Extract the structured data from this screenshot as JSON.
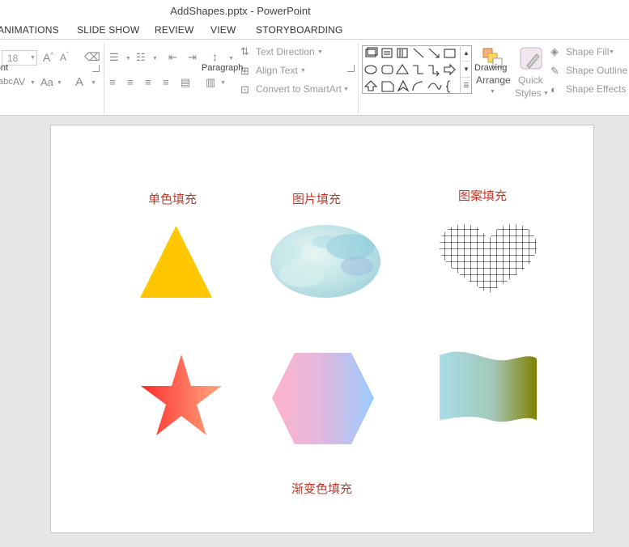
{
  "window": {
    "title": "AddShapes.pptx - PowerPoint"
  },
  "tabs": [
    "ANIMATIONS",
    "SLIDE SHOW",
    "REVIEW",
    "VIEW",
    "STORYBOARDING"
  ],
  "ribbon": {
    "font_group_label": "Font",
    "font_size": "18",
    "paragraph_group_label": "Paragraph",
    "drawing_group_label": "Drawing",
    "text_direction": "Text Direction",
    "align_text": "Align Text",
    "convert_smartart": "Convert to SmartArt",
    "arrange": "Arrange",
    "quick_styles_line1": "Quick",
    "quick_styles_line2": "Styles",
    "shape_fill": "Shape Fill",
    "shape_outline": "Shape Outline",
    "shape_effects": "Shape Effects"
  },
  "slide": {
    "label_solid": "单色填充",
    "label_picture": "图片填充",
    "label_pattern": "图案填充",
    "label_gradient": "渐变色填充",
    "colors": {
      "triangle": "#FFC700",
      "star_start": "#FF2D2D",
      "star_end": "#FFAA80",
      "hexagon_start": "#FFB3CC",
      "hexagon_end": "#99CCFF",
      "wave_start": "#A8DDE8",
      "wave_end": "#808000",
      "label": "#C0392B"
    }
  }
}
